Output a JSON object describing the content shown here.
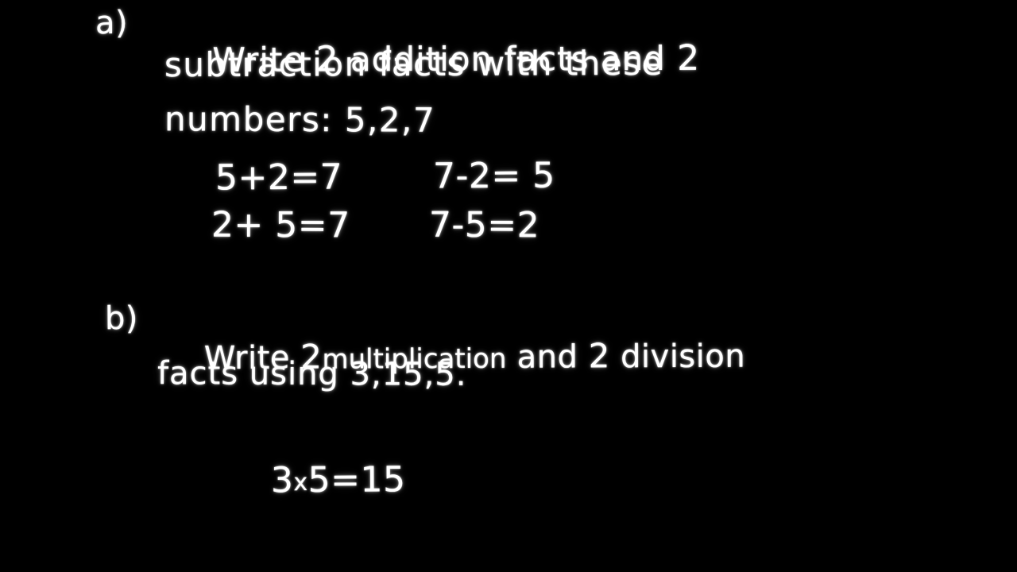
{
  "board": {
    "background_color": "#000000",
    "ink_color": "#ffffff",
    "style": "handwritten-whiteboard"
  },
  "problems": [
    {
      "label": "a)",
      "prompt_lines": [
        "Write 2 addition facts and 2",
        "subtraction facts with these",
        "numbers: 5,2,7"
      ],
      "given_numbers": "5,2,7",
      "answers": [
        {
          "text": "5+2=7",
          "column": "left",
          "row": 1
        },
        {
          "text": "7-2= 5",
          "column": "right",
          "row": 1
        },
        {
          "text": "2+ 5=7",
          "column": "left",
          "row": 2
        },
        {
          "text": "7-5=2",
          "column": "right",
          "row": 2
        }
      ]
    },
    {
      "label": "b)",
      "prompt_lines": [
        "Write 2 multiplication and 2 division",
        "facts using 3,15,5."
      ],
      "given_numbers": "3,15,5",
      "answers": [
        {
          "text": "3x5=15",
          "column": "left",
          "row": 1
        }
      ]
    }
  ],
  "a_line1": {
    "pre": "Write ",
    "count1": "2",
    "mid": " addition facts and ",
    "count2": "2"
  },
  "a_line2": "subtraction facts with these",
  "a_line3": "numbers: 5,2,7",
  "a_eq": {
    "r1c1": "5+2=7",
    "r1c2": "7-2= 5",
    "r2c1": "2+ 5=7",
    "r2c2": "7-5=2"
  },
  "b_line1": {
    "pre": "Write ",
    "count1": "2",
    "word1": "multiplication",
    "mid": " and ",
    "count2": "2",
    "word2": " division"
  },
  "b_line2": "facts using 3,15,5.",
  "b_eq": {
    "lhs1": "3",
    "times": "x",
    "lhs2": "5",
    "rhs": "=15"
  }
}
